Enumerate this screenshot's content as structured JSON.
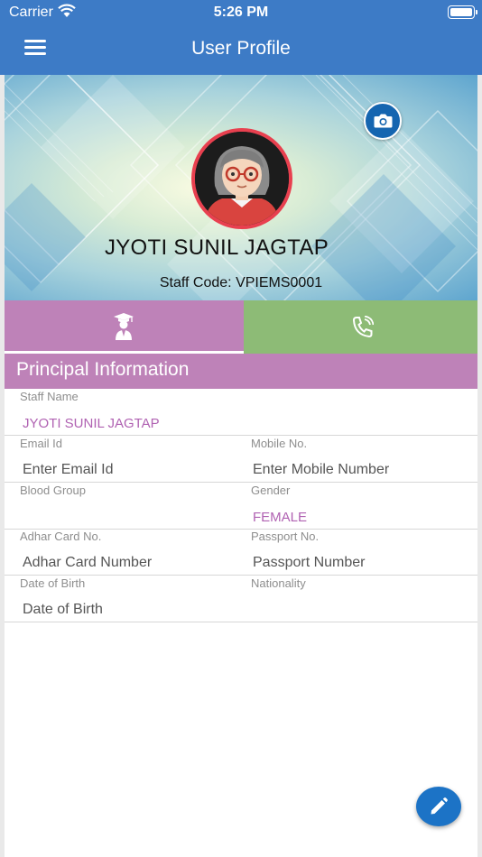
{
  "status_bar": {
    "carrier": "Carrier",
    "time": "5:26 PM"
  },
  "header": {
    "title": "User Profile"
  },
  "profile": {
    "name": "JYOTI SUNIL JAGTAP",
    "staff_code": "Staff Code: VPIEMS0001"
  },
  "tabs": [
    {
      "icon": "graduate-icon",
      "color": "#be82b8"
    },
    {
      "icon": "phone-call-icon",
      "color": "#8dbb76"
    }
  ],
  "section": {
    "title": "Principal Information"
  },
  "fields": {
    "staff_name": {
      "label": "Staff Name",
      "value": "JYOTI SUNIL JAGTAP"
    },
    "email": {
      "label": "Email Id",
      "placeholder": "Enter Email Id"
    },
    "mobile": {
      "label": "Mobile No.",
      "placeholder": "Enter Mobile Number"
    },
    "blood_group": {
      "label": "Blood Group",
      "value": ""
    },
    "gender": {
      "label": "Gender",
      "value": "FEMALE"
    },
    "adhar": {
      "label": "Adhar Card No.",
      "placeholder": "Adhar Card Number"
    },
    "passport": {
      "label": "Passport No.",
      "placeholder": "Passport Number"
    },
    "dob": {
      "label": "Date of Birth",
      "placeholder": "Date of Birth"
    },
    "nationality": {
      "label": "Nationality",
      "value": ""
    }
  },
  "colors": {
    "header": "#3d7bc6",
    "accent_purple": "#be82b8",
    "accent_green": "#8dbb76",
    "fab": "#1c73c6"
  }
}
